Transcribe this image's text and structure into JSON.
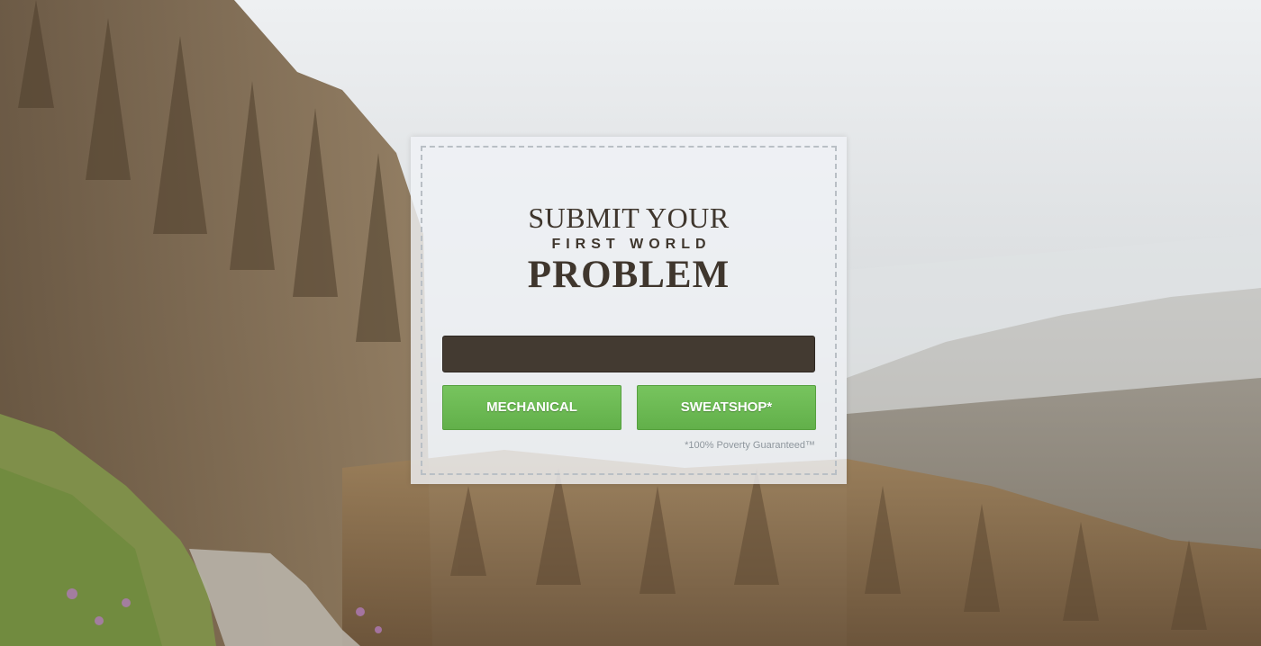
{
  "card": {
    "title_line1": "SUBMIT YOUR",
    "title_line2": "FIRST WORLD",
    "title_line3": "PROBLEM"
  },
  "form": {
    "problem_input": {
      "value": "",
      "placeholder": ""
    },
    "buttons": {
      "mechanical_label": "MECHANICAL",
      "sweatshop_label": "SWEATSHOP*"
    },
    "footnote": "*100% Poverty Guaranteed™"
  },
  "colors": {
    "card_background": "#f0f3f6",
    "title_text": "#3f362d",
    "input_background": "#433a31",
    "button_green": "#6cba53",
    "footnote_text": "#8e969d"
  }
}
